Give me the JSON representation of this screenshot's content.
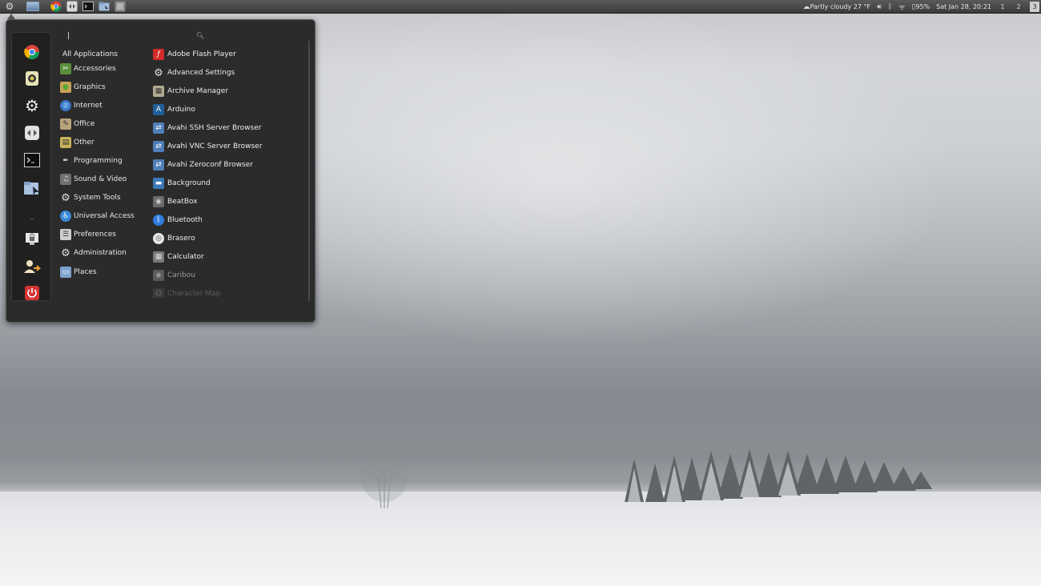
{
  "panel": {
    "weather": "Partly cloudy 27 °F",
    "battery": "95%",
    "datetime": "Sat Jan 28, 20:21",
    "workspaces": [
      "1",
      "2",
      "3"
    ]
  },
  "menu": {
    "search": {
      "value": "",
      "placeholder": ""
    },
    "categories": [
      "All Applications",
      "Accessories",
      "Graphics",
      "Internet",
      "Office",
      "Other",
      "Programming",
      "Sound & Video",
      "System Tools",
      "Universal Access",
      "Preferences",
      "Administration",
      "Places"
    ],
    "apps": [
      "Adobe Flash Player",
      "Advanced Settings",
      "Archive Manager",
      "Arduino",
      "Avahi SSH Server Browser",
      "Avahi VNC Server Browser",
      "Avahi Zeroconf Browser",
      "Background",
      "BeatBox",
      "Bluetooth",
      "Brasero",
      "Calculator",
      "Caribou",
      "Character Map"
    ],
    "favorites": [
      "chrome-icon",
      "disk-icon",
      "settings-icon",
      "remote-icon",
      "terminal-icon",
      "files-icon",
      "lock-screen-icon",
      "user-switch-icon",
      "power-icon"
    ]
  },
  "colors": {
    "menu_bg": "#2b2b2b",
    "panel_bg": "#3b3b3b",
    "accent_red": "#d63232"
  }
}
